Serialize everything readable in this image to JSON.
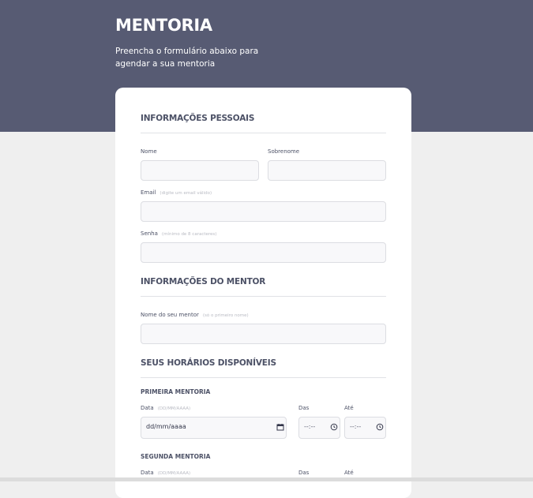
{
  "header": {
    "title": "MENTORIA",
    "subtitle": "Preencha o formulário abaixo para agendar a sua mentoria"
  },
  "form": {
    "personal": {
      "title": "INFORMAÇÕES PESSOAIS",
      "first_name_label": "Nome",
      "last_name_label": "Sobrenome",
      "email_label": "Email",
      "email_hint": "(digite um email válido)",
      "password_label": "Senha",
      "password_hint": "(mínimo de 8 caracteres)"
    },
    "mentor": {
      "title": "INFORMAÇÕES DO MENTOR",
      "mentor_name_label": "Nome do seu mentor",
      "mentor_name_hint": "(só o primeiro nome)"
    },
    "schedule": {
      "title": "SEUS HORÁRIOS DISPONÍVEIS",
      "first": {
        "title": "PRIMEIRA MENTORIA",
        "date_label": "Data",
        "date_hint": "(DD/MM/AAAA)",
        "date_value": "dd/mm/aaaa",
        "from_label": "Das",
        "from_value": "--:--",
        "to_label": "Até",
        "to_value": "--:--"
      },
      "second": {
        "title": "SEGUNDA MENTORIA",
        "date_label": "Data",
        "date_hint": "(DD/MM/AAAA)",
        "from_label": "Das",
        "to_label": "Até"
      }
    }
  },
  "icons": {
    "calendar": "calendar-icon",
    "clock": "clock-icon"
  },
  "colors": {
    "header_bg": "#575b73",
    "page_bg": "#efefef",
    "card_bg": "#ffffff",
    "input_bg": "#f8f8fa",
    "heading_text": "#4c5166"
  }
}
